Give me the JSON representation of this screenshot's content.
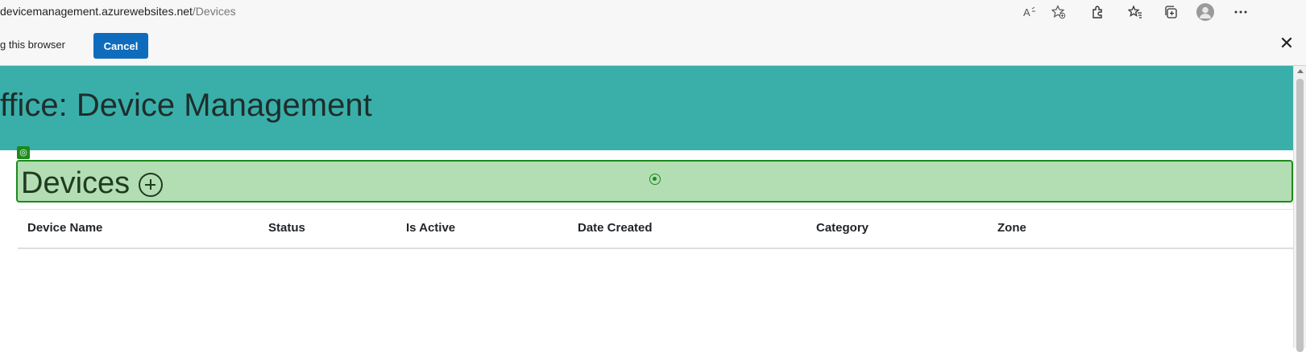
{
  "browser": {
    "url_host": "devicemanagement.azurewebsites.net",
    "url_path": "/Devices",
    "toolbar_icons": [
      "read-aloud-icon",
      "add-favorite-icon",
      "extensions-icon",
      "favorites-icon",
      "collections-icon",
      "profile-avatar",
      "more-menu-icon"
    ]
  },
  "infobar": {
    "text": "g this browser",
    "cancel_label": "Cancel",
    "close_glyph": "✕"
  },
  "banner": {
    "title": "ffice: Device Management",
    "color": "#3aafa9"
  },
  "section": {
    "title": "Devices",
    "highlight_color": "#b3ddb3",
    "highlight_border": "#1c8a1c"
  },
  "table": {
    "columns": [
      "Device Name",
      "Status",
      "Is Active",
      "Date Created",
      "Category",
      "Zone"
    ],
    "rows": []
  }
}
